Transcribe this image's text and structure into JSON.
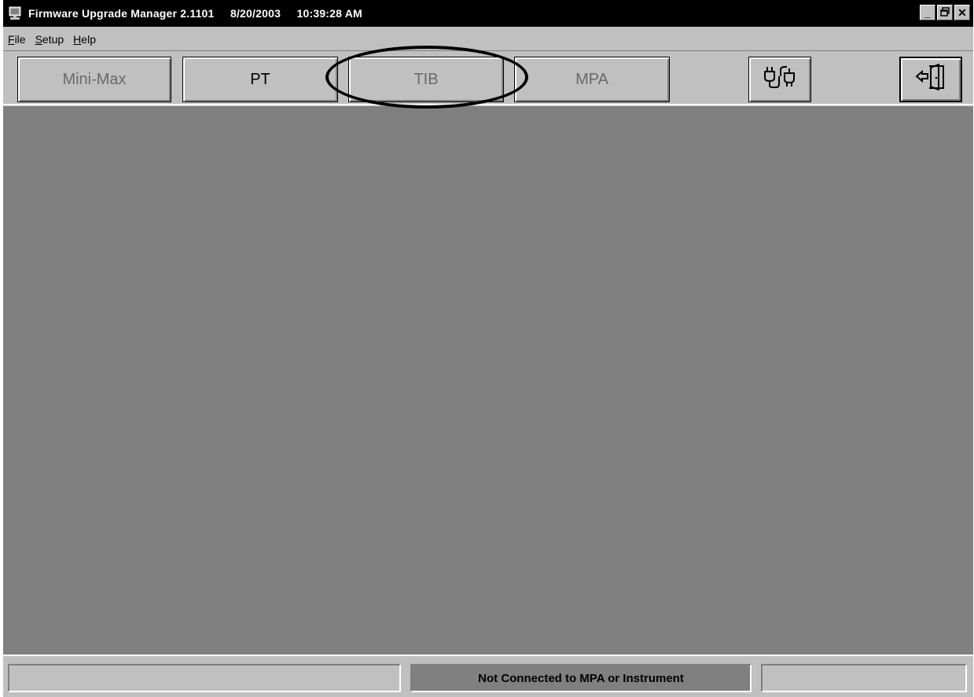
{
  "window": {
    "title": "Firmware Upgrade Manager 2.1101     8/20/2003     10:39:28 AM",
    "controls": {
      "minimize": "_",
      "maximize": "▣",
      "close": "✕"
    }
  },
  "menu": {
    "file_acc": "F",
    "file_rest": "ile",
    "setup_acc": "S",
    "setup_rest": "etup",
    "help_acc": "H",
    "help_rest": "elp"
  },
  "toolbar": {
    "minimax": "Mini-Max",
    "pt": "PT",
    "tib": "TIB",
    "mpa": "MPA",
    "connect_icon": "connect-plug-icon",
    "exit_icon": "exit-door-icon"
  },
  "status": {
    "left": "",
    "center": "Not Connected to MPA or Instrument",
    "right": ""
  },
  "colors": {
    "titlebar": "#000000",
    "face": "#c0c0c0",
    "client": "#808080",
    "status_center": "#808080"
  }
}
